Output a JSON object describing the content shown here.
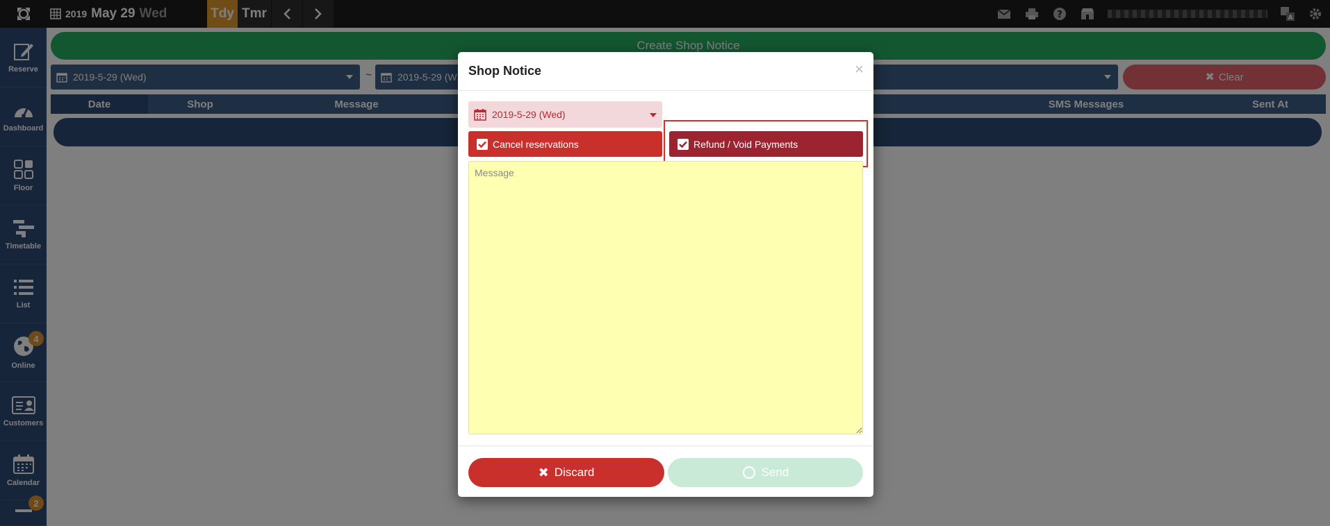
{
  "topbar": {
    "year": "2019",
    "month_day": "May 29",
    "weekday": "Wed",
    "today_label": "Tdy",
    "tomorrow_label": "Tmr"
  },
  "sidebar": {
    "items": [
      {
        "label": "Reserve",
        "icon": "edit-icon"
      },
      {
        "label": "Dashboard",
        "icon": "gauge-icon"
      },
      {
        "label": "Floor",
        "icon": "grid-icon"
      },
      {
        "label": "Timetable",
        "icon": "timetable-icon"
      },
      {
        "label": "List",
        "icon": "list-icon"
      },
      {
        "label": "Online",
        "icon": "globe-icon",
        "badge": "4"
      },
      {
        "label": "Customers",
        "icon": "id-card-icon"
      },
      {
        "label": "Calendar",
        "icon": "calendar-icon"
      }
    ],
    "bottom_badge": "2"
  },
  "main": {
    "create_label": "Create Shop Notice",
    "from_date": "2019-5-29 (Wed)",
    "to_date": "2019-5-29 (W",
    "tilde": "~",
    "clear_label": "Clear",
    "columns": [
      "Date",
      "Shop",
      "Message",
      "SMS Messages",
      "Sent At"
    ]
  },
  "modal": {
    "title": "Shop Notice",
    "close": "×",
    "date": "2019-5-29 (Wed)",
    "cancel_label": "Cancel reservations",
    "refund_label": "Refund / Void Payments",
    "message_placeholder": "Message",
    "discard_label": "Discard",
    "send_label": "Send"
  },
  "colors": {
    "sidebar": "#2d4a73",
    "create": "#27ae60",
    "danger": "#c9302c",
    "today": "#e09a2e",
    "message_bg": "#ffffb2"
  }
}
